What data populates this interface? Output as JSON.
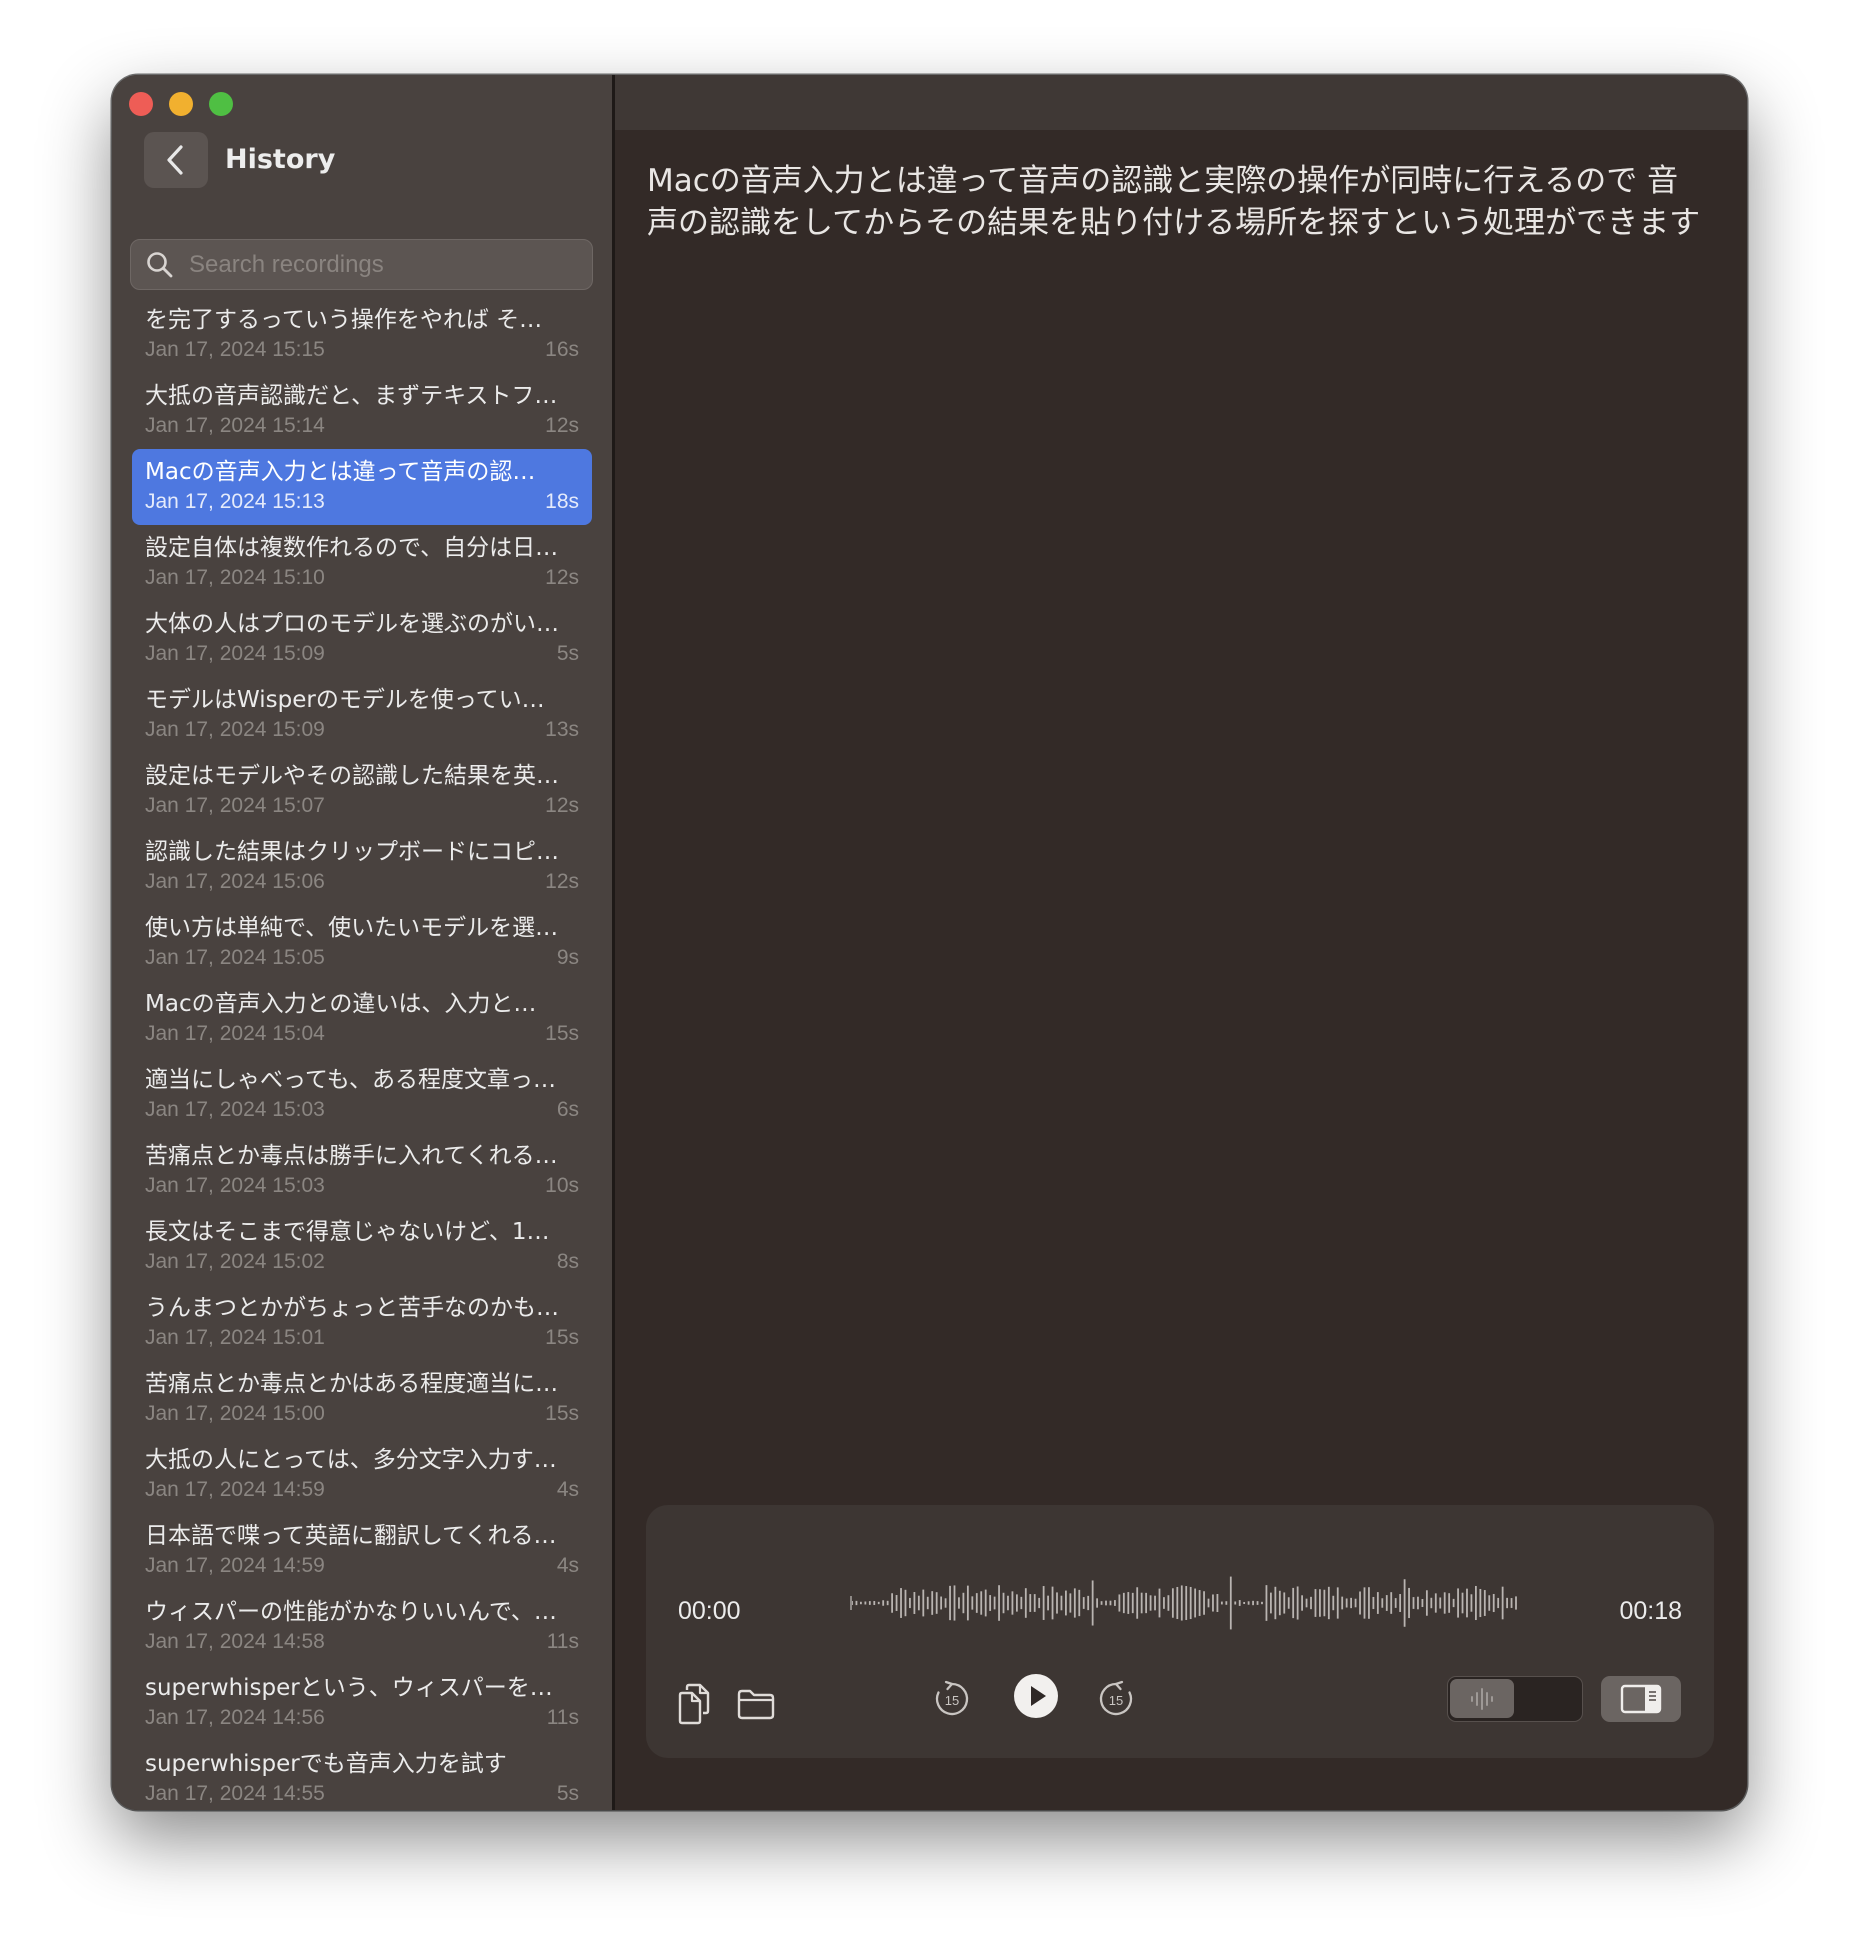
{
  "window": {
    "controls": [
      "close",
      "minimize",
      "zoom"
    ]
  },
  "sidebar": {
    "title": "History",
    "back_icon": "chevron-left-icon",
    "search": {
      "placeholder": "Search recordings",
      "value": "",
      "icon": "search-icon"
    },
    "selected_index": 2,
    "recordings": [
      {
        "title": "を完了するっていう操作をやれば そ…",
        "date": "Jan 17, 2024 15:15",
        "duration": "16s"
      },
      {
        "title": "大抵の音声認識だと、まずテキストフ…",
        "date": "Jan 17, 2024 15:14",
        "duration": "12s"
      },
      {
        "title": "Macの音声入力とは違って音声の認…",
        "date": "Jan 17, 2024 15:13",
        "duration": "18s"
      },
      {
        "title": "設定自体は複数作れるので、自分は日…",
        "date": "Jan 17, 2024 15:10",
        "duration": "12s"
      },
      {
        "title": "大体の人はプロのモデルを選ぶのがい…",
        "date": "Jan 17, 2024 15:09",
        "duration": "5s"
      },
      {
        "title": "モデルはWisperのモデルを使ってい…",
        "date": "Jan 17, 2024 15:09",
        "duration": "13s"
      },
      {
        "title": "設定はモデルやその認識した結果を英…",
        "date": "Jan 17, 2024 15:07",
        "duration": "12s"
      },
      {
        "title": "認識した結果はクリップボードにコピ…",
        "date": "Jan 17, 2024 15:06",
        "duration": "12s"
      },
      {
        "title": "使い方は単純で、使いたいモデルを選…",
        "date": "Jan 17, 2024 15:05",
        "duration": "9s"
      },
      {
        "title": "Macの音声入力との違いは、入力と…",
        "date": "Jan 17, 2024 15:04",
        "duration": "15s"
      },
      {
        "title": "適当にしゃべっても、ある程度文章っ…",
        "date": "Jan 17, 2024 15:03",
        "duration": "6s"
      },
      {
        "title": "苦痛点とか毒点は勝手に入れてくれる…",
        "date": "Jan 17, 2024 15:03",
        "duration": "10s"
      },
      {
        "title": "長文はそこまで得意じゃないけど、1…",
        "date": "Jan 17, 2024 15:02",
        "duration": "8s"
      },
      {
        "title": "うんまつとかがちょっと苦手なのかも…",
        "date": "Jan 17, 2024 15:01",
        "duration": "15s"
      },
      {
        "title": "苦痛点とか毒点とかはある程度適当に…",
        "date": "Jan 17, 2024 15:00",
        "duration": "15s"
      },
      {
        "title": "大抵の人にとっては、多分文字入力す…",
        "date": "Jan 17, 2024 14:59",
        "duration": "4s"
      },
      {
        "title": "日本語で喋って英語に翻訳してくれる…",
        "date": "Jan 17, 2024 14:59",
        "duration": "4s"
      },
      {
        "title": "ウィスパーの性能がかなりいいんで、…",
        "date": "Jan 17, 2024 14:58",
        "duration": "11s"
      },
      {
        "title": "superwhisperという、ウィスパーを…",
        "date": "Jan 17, 2024 14:56",
        "duration": "11s"
      },
      {
        "title": "superwhisperでも音声入力を試す",
        "date": "Jan 17, 2024 14:55",
        "duration": "5s"
      }
    ]
  },
  "main": {
    "transcript": "Macの音声入力とは違って音声の認識と実際の操作が同時に行えるので 音声の認識をしてからその結果を貼り付ける場所を探すという処理ができます"
  },
  "player": {
    "current_time": "00:00",
    "total_time": "00:18",
    "progress": 0,
    "buttons": {
      "copy": "copy-icon",
      "folder": "folder-icon",
      "rewind": "rewind-15-icon",
      "play": "play-icon",
      "forward": "forward-15-icon",
      "waveform_toggle": "waveform-icon",
      "sidebar_toggle": "sidebar-right-icon"
    },
    "skip_seconds": "15"
  },
  "colors": {
    "selection": "#4e78e0",
    "sidebar_bg": "#49423f",
    "main_bg": "#332a27",
    "player_bg": "#3d3633"
  }
}
